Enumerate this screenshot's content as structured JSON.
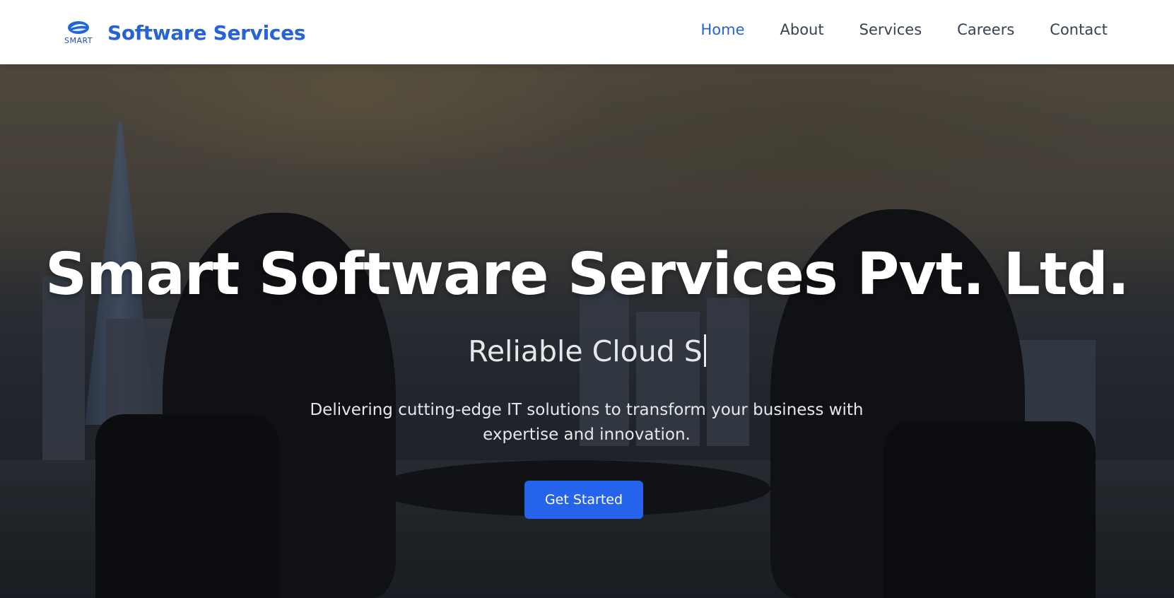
{
  "header": {
    "logo_text": "SMART",
    "brand_name": "Software Services",
    "nav": [
      {
        "label": "Home",
        "active": true
      },
      {
        "label": "About",
        "active": false
      },
      {
        "label": "Services",
        "active": false
      },
      {
        "label": "Careers",
        "active": false
      },
      {
        "label": "Contact",
        "active": false
      }
    ]
  },
  "hero": {
    "title": "Smart Software Services Pvt. Ltd.",
    "typing_text": "Reliable Cloud S",
    "tagline": "Delivering cutting-edge IT solutions to transform your business with expertise and innovation.",
    "cta_label": "Get Started",
    "background_image": "business-meeting-city-skyline"
  },
  "colors": {
    "brand": "#2563d6",
    "nav_text": "#374151",
    "cta": "#2563eb"
  }
}
